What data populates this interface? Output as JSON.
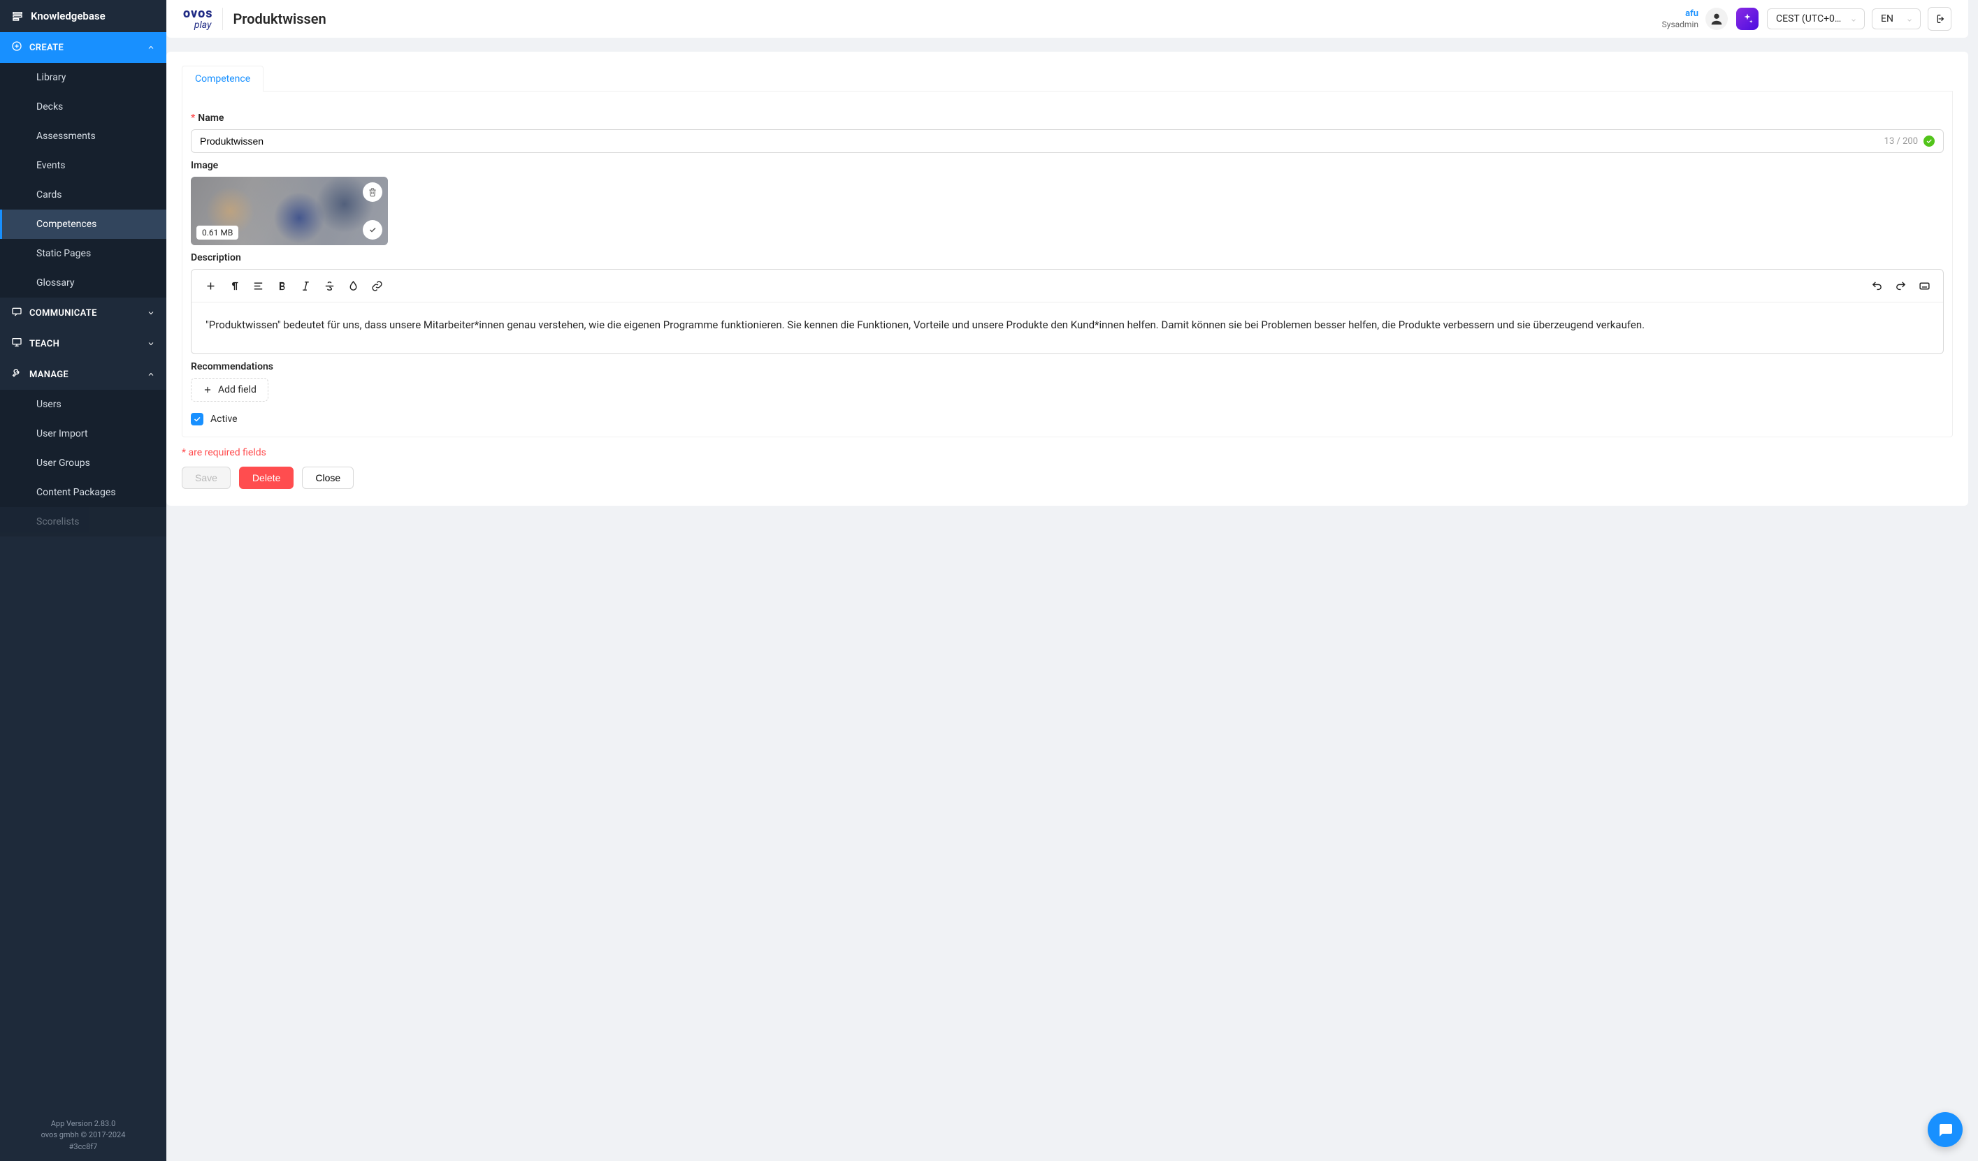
{
  "sidebar": {
    "title": "Knowledgebase",
    "groups": {
      "create": {
        "label": "CREATE",
        "expanded": true,
        "items": [
          {
            "label": "Library"
          },
          {
            "label": "Decks"
          },
          {
            "label": "Assessments"
          },
          {
            "label": "Events"
          },
          {
            "label": "Cards"
          },
          {
            "label": "Competences",
            "selected": true
          },
          {
            "label": "Static Pages"
          },
          {
            "label": "Glossary"
          }
        ]
      },
      "communicate": {
        "label": "COMMUNICATE",
        "expanded": false
      },
      "teach": {
        "label": "TEACH",
        "expanded": false
      },
      "manage": {
        "label": "MANAGE",
        "expanded": true,
        "items": [
          {
            "label": "Users"
          },
          {
            "label": "User Import"
          },
          {
            "label": "User Groups"
          },
          {
            "label": "Content Packages"
          },
          {
            "label": "Scorelists"
          }
        ]
      }
    },
    "footer": {
      "line1": "App Version 2.83.0",
      "line2": "ovos gmbh © 2017-2024",
      "line3": "#3cc8f7"
    }
  },
  "header": {
    "brand_primary": "ovos",
    "brand_secondary": "play",
    "page_title": "Produktwissen",
    "user_name": "afu",
    "user_role": "Sysadmin",
    "timezone": "CEST (UTC+0…",
    "language": "EN"
  },
  "tabs": {
    "competence": "Competence"
  },
  "form": {
    "name_label": "Name",
    "name_value": "Produktwissen",
    "name_count": "13 / 200",
    "image_label": "Image",
    "image_size": "0.61 MB",
    "description_label": "Description",
    "description_text": "\"Produktwissen\" bedeutet für uns, dass unsere Mitarbeiter*innen genau verstehen, wie die eigenen Programme funktionieren. Sie kennen die Funktionen, Vorteile und unsere Produkte den Kund*innen helfen. Damit können sie bei Problemen besser helfen, die Produkte verbessern und sie überzeugend verkaufen.",
    "recommendations_label": "Recommendations",
    "add_field_label": "Add field",
    "active_label": "Active",
    "active_checked": true
  },
  "footer": {
    "required_note": "* are required fields",
    "save": "Save",
    "delete": "Delete",
    "close": "Close"
  }
}
